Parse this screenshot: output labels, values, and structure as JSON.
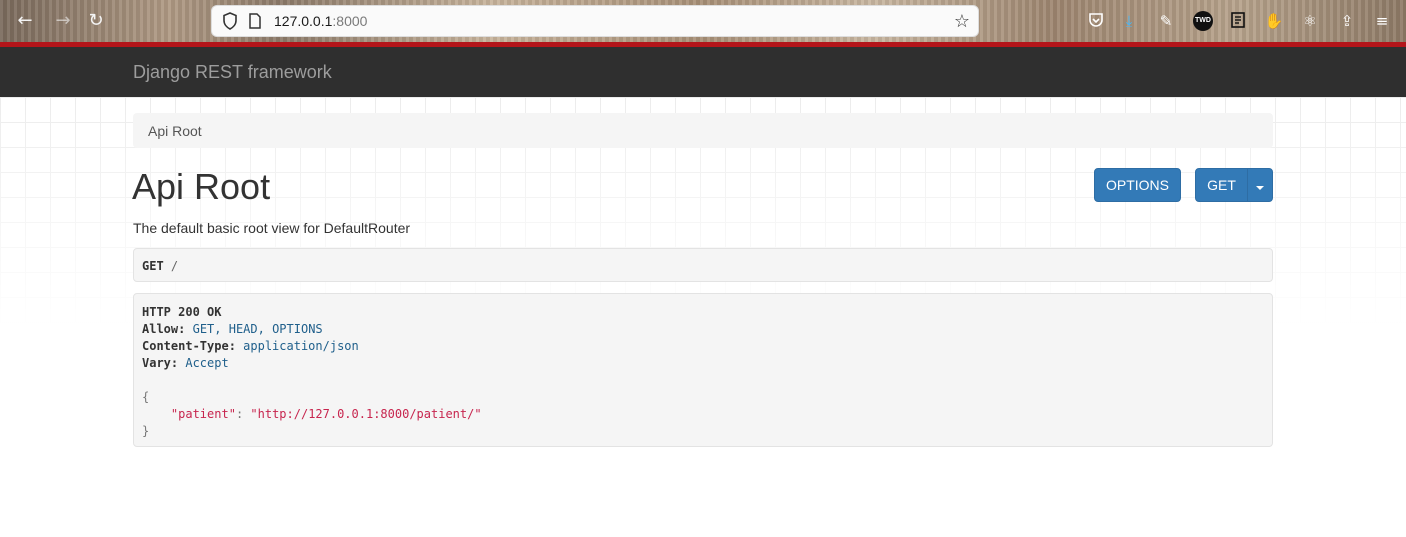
{
  "browser": {
    "url_host": "127.0.0.1",
    "url_port": ":8000",
    "extensions": [
      "pocket-icon",
      "download-icon",
      "wrench-icon",
      "twd-icon",
      "notes-icon",
      "hand-icon",
      "react-icon",
      "share-icon",
      "menu-icon"
    ],
    "twd_label": "TWD"
  },
  "navbar": {
    "brand": "Django REST framework"
  },
  "breadcrumb": {
    "item": "Api Root"
  },
  "page": {
    "title": "Api Root",
    "description": "The default basic root view for DefaultRouter"
  },
  "buttons": {
    "options": "OPTIONS",
    "get": "GET"
  },
  "request": {
    "method": "GET",
    "path": "/"
  },
  "response": {
    "status": "HTTP 200 OK",
    "headers": [
      {
        "name": "Allow:",
        "value": "GET, HEAD, OPTIONS"
      },
      {
        "name": "Content-Type:",
        "value": "application/json"
      },
      {
        "name": "Vary:",
        "value": "Accept"
      }
    ],
    "open_brace": "{",
    "close_brace": "}",
    "body_key": "\"patient\"",
    "body_sep": ": ",
    "body_value": "\"http://127.0.0.1:8000/patient/\""
  },
  "colors": {
    "accent_red": "#b3151a",
    "navbar_bg": "#2f2f2f",
    "button_blue": "#337ab7",
    "json_string": "#c7254e",
    "header_value": "#1f5f8b"
  }
}
